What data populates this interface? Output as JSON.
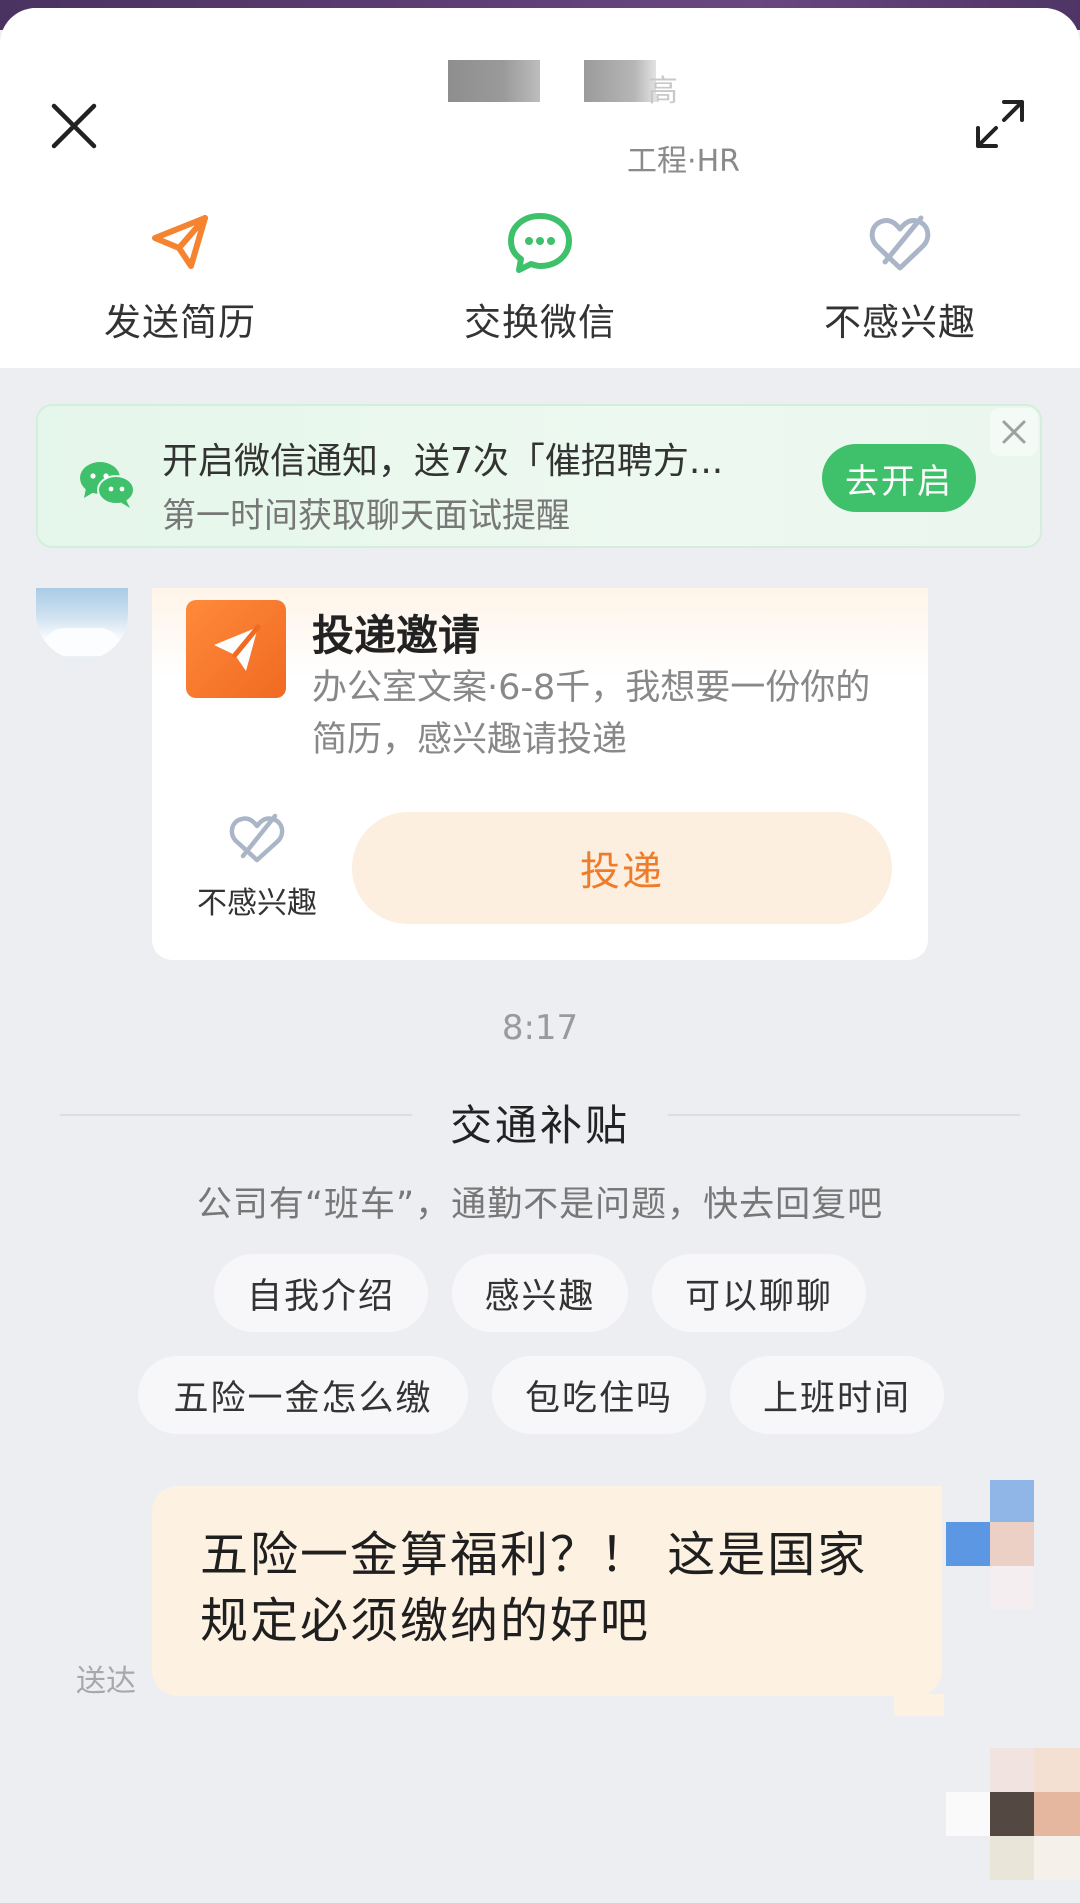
{
  "header": {
    "hr_name_suffix": "高",
    "hr_subtitle": "工程·HR",
    "close_icon": "close-icon",
    "expand_icon": "expand-icon"
  },
  "actions": [
    {
      "label": "发送简历",
      "icon": "paper-plane-icon",
      "color": "#f5832f"
    },
    {
      "label": "交换微信",
      "icon": "wechat-icon",
      "color": "#3fc06b"
    },
    {
      "label": "不感兴趣",
      "icon": "broken-heart-icon",
      "color": "#aab6c8"
    }
  ],
  "banner": {
    "title": "开启微信通知，送7次「催招聘方...",
    "subtitle": "第一时间获取聊天面试提醒",
    "button": "去开启",
    "accent": "#3fc06b"
  },
  "invite_card": {
    "title": "投递邀请",
    "description": "办公室文案·6-8千，我想要一份你的简历，感兴趣请投递",
    "not_interested": "不感兴趣",
    "deliver_button": "投递",
    "accent": "#ef7c2a"
  },
  "chat": {
    "time": "8:17",
    "section_title": "交通补贴",
    "section_subtitle": "公司有“班车”，通勤不是问题，快去回复吧",
    "chips": [
      "自我介绍",
      "感兴趣",
      "可以聊聊",
      "五险一金怎么缴",
      "包吃住吗",
      "上班时间"
    ],
    "my_message": "五险一金算福利？！ 这是国家规定必须缴纳的好吧",
    "status": "送达"
  }
}
